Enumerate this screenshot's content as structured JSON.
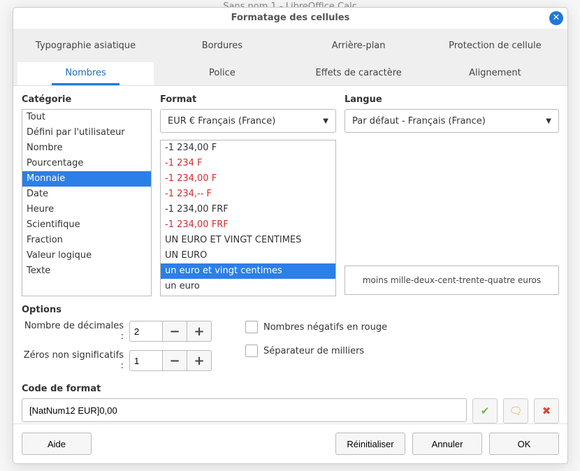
{
  "bg_window_title": "Sans nom 1 - LibreOffice Calc",
  "dialog_title": "Formatage des cellules",
  "tabs_top": {
    "t0": "Typographie asiatique",
    "t1": "Bordures",
    "t2": "Arrière-plan",
    "t3": "Protection de cellule"
  },
  "tabs_bottom": {
    "t0": "Nombres",
    "t1": "Police",
    "t2": "Effets de caractère",
    "t3": "Alignement"
  },
  "labels": {
    "category": "Catégorie",
    "format": "Format",
    "language": "Langue",
    "options": "Options",
    "decimals": "Nombre de décimales :",
    "leading_zeros": "Zéros non significatifs :",
    "neg_red": "Nombres négatifs en rouge",
    "thousands": "Séparateur de milliers",
    "format_code": "Code de format"
  },
  "category": {
    "items": {
      "i0": "Tout",
      "i1": "Défini par l'utilisateur",
      "i2": "Nombre",
      "i3": "Pourcentage",
      "i4": "Monnaie",
      "i5": "Date",
      "i6": "Heure",
      "i7": "Scientifique",
      "i8": "Fraction",
      "i9": "Valeur logique",
      "i10": "Texte"
    },
    "selected_index": 4
  },
  "format_dropdown": {
    "value": "EUR €   Français (France)"
  },
  "format_list": {
    "items": {
      "i0": {
        "text": "-1 234,00 F",
        "red": false
      },
      "i1": {
        "text": "-1 234 F",
        "red": true
      },
      "i2": {
        "text": "-1 234,00 F",
        "red": true
      },
      "i3": {
        "text": "-1 234,-- F",
        "red": true
      },
      "i4": {
        "text": "-1 234,00 FRF",
        "red": false
      },
      "i5": {
        "text": "-1 234,00 FRF",
        "red": true
      },
      "i6": {
        "text": "UN EURO ET VINGT CENTIMES",
        "red": false
      },
      "i7": {
        "text": "UN EURO",
        "red": false
      },
      "i8": {
        "text": "un euro et vingt centimes",
        "red": false
      },
      "i9": {
        "text": "un euro",
        "red": false
      }
    },
    "selected_index": 8
  },
  "language_dropdown": {
    "value": "Par défaut - Français (France)"
  },
  "preview": "moins mille-deux-cent-trente-quatre euros",
  "options": {
    "decimals": "2",
    "leading_zeros": "1"
  },
  "format_code_value": "[NatNum12 EUR]0,00",
  "buttons": {
    "help": "Aide",
    "reset": "Réinitialiser",
    "cancel": "Annuler",
    "ok": "OK"
  },
  "icons": {
    "check_color": "#6eb04a",
    "note_color": "#e8a63b",
    "delete_color": "#d24a3a"
  }
}
